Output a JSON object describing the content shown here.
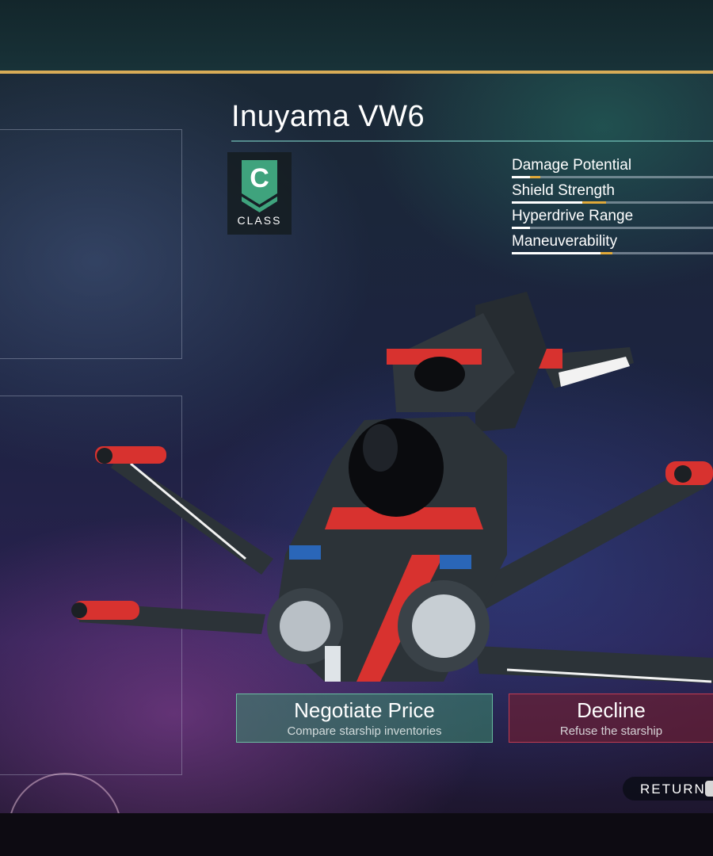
{
  "ship": {
    "name": "Inuyama VW6",
    "class_letter": "C",
    "class_label": "CLASS",
    "badge_color": "#3fa37d"
  },
  "stats": [
    {
      "label": "Damage Potential",
      "base": 0.09,
      "bonus": 0.05
    },
    {
      "label": "Shield Strength",
      "base": 0.35,
      "bonus": 0.12
    },
    {
      "label": "Hyperdrive Range",
      "base": 0.09,
      "bonus": 0.0
    },
    {
      "label": "Maneuverability",
      "base": 0.44,
      "bonus": 0.06
    }
  ],
  "actions": {
    "negotiate": {
      "title": "Negotiate Price",
      "subtitle": "Compare starship inventories"
    },
    "decline": {
      "title": "Decline",
      "subtitle": "Refuse the starship"
    }
  },
  "return": {
    "label": "RETURN",
    "key_icon": "keyboard-key-icon"
  },
  "colors": {
    "accent_gold": "#d8ac57",
    "negotiate": "#3c8c6e",
    "decline": "#6e1e32",
    "ship_red": "#d8322f",
    "ship_hull": "#2c3338"
  }
}
